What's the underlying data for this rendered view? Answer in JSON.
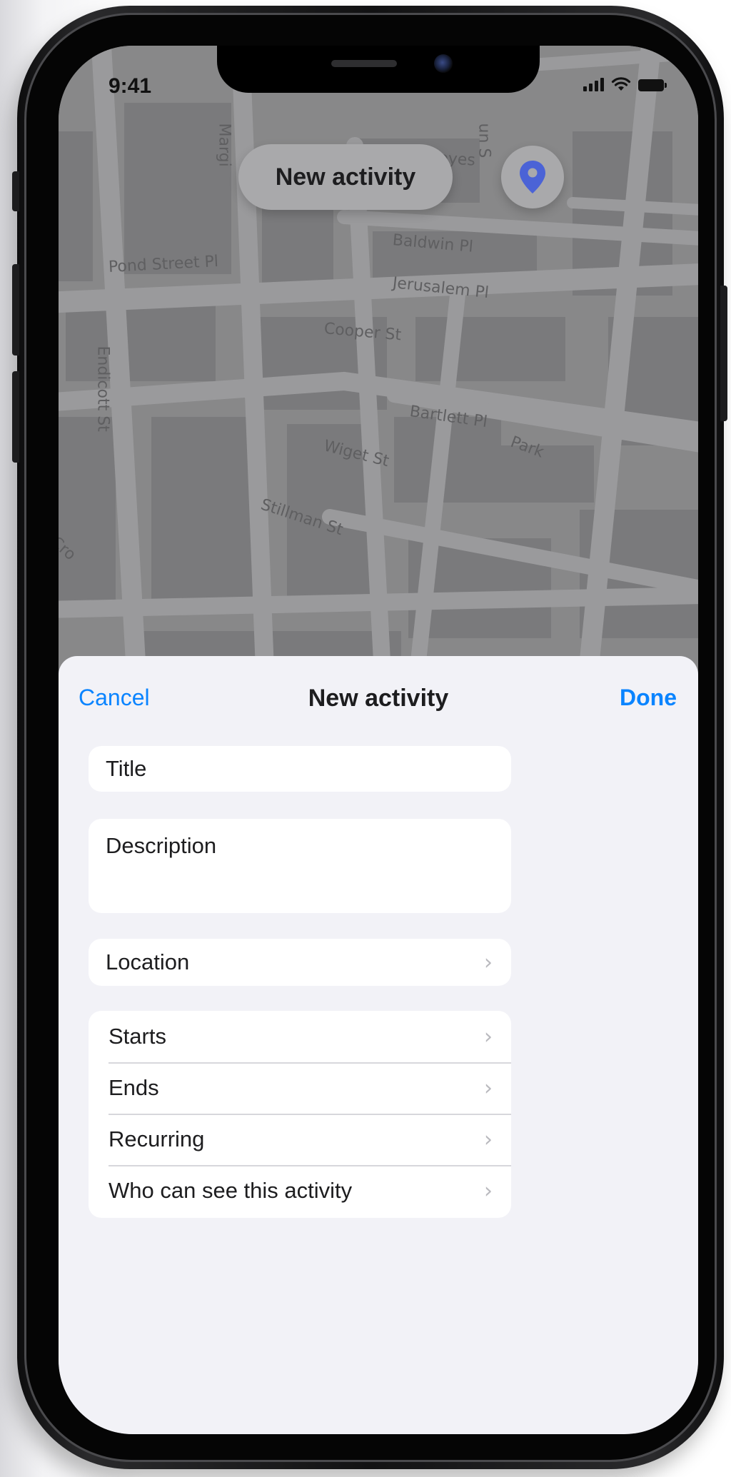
{
  "status_bar": {
    "time": "9:41",
    "icons": [
      "signal-icon",
      "wifi-icon",
      "battery-icon"
    ]
  },
  "map": {
    "title_pill": "New activity",
    "location_button_icon": "map-pin-icon",
    "street_labels": {
      "margin": "Margi",
      "noyes": "Noyes",
      "un": "un S",
      "baldwin": "Baldwin Pl",
      "pond_street": "Pond Street Pl",
      "jerusalem": "Jerusalem Pl",
      "cooper": "Cooper St",
      "endicott": "Endicott St",
      "bartlett": "Bartlett Pl",
      "wiget": "Wiget St",
      "park": "Park",
      "stillman": "Stillman St",
      "cross": "Cro"
    }
  },
  "sheet": {
    "cancel_label": "Cancel",
    "title": "New activity",
    "done_label": "Done",
    "title_field": "Title",
    "description_field": "Description",
    "location_row": "Location",
    "settings_rows": [
      "Starts",
      "Ends",
      "Recurring",
      "Who can see this activity"
    ]
  },
  "colors": {
    "accent": "#0a84ff",
    "pin": "#4b63d6",
    "sheet_background": "#f2f2f7",
    "map_background": "#888889"
  }
}
